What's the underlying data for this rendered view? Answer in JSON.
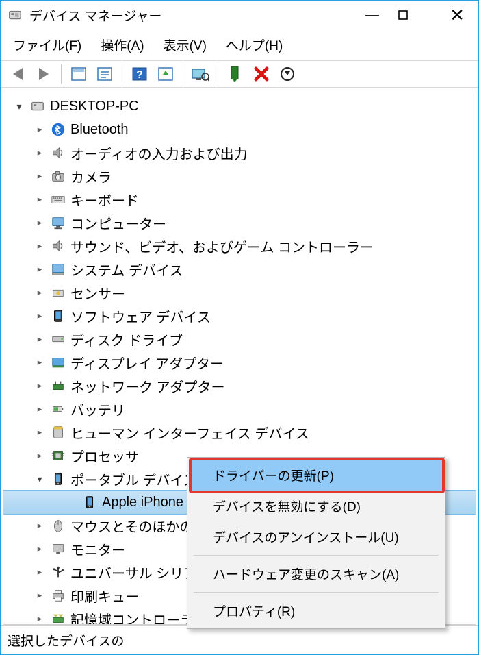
{
  "title": "デバイス マネージャー",
  "menus": {
    "file": "ファイル(F)",
    "action": "操作(A)",
    "view": "表示(V)",
    "help": "ヘルプ(H)"
  },
  "root_node": "DESKTOP-PC",
  "categories": [
    {
      "key": "bluetooth",
      "label": "Bluetooth",
      "icon": "bluetooth"
    },
    {
      "key": "audio_io",
      "label": "オーディオの入力および出力",
      "icon": "speaker"
    },
    {
      "key": "camera",
      "label": "カメラ",
      "icon": "camera"
    },
    {
      "key": "keyboard",
      "label": "キーボード",
      "icon": "keyboard"
    },
    {
      "key": "computer",
      "label": "コンピューター",
      "icon": "monitor"
    },
    {
      "key": "sound",
      "label": "サウンド、ビデオ、およびゲーム コントローラー",
      "icon": "speaker"
    },
    {
      "key": "system",
      "label": "システム デバイス",
      "icon": "system"
    },
    {
      "key": "sensor",
      "label": "センサー",
      "icon": "sensor"
    },
    {
      "key": "software",
      "label": "ソフトウェア デバイス",
      "icon": "software"
    },
    {
      "key": "disk",
      "label": "ディスク ドライブ",
      "icon": "disk"
    },
    {
      "key": "display",
      "label": "ディスプレイ アダプター",
      "icon": "display"
    },
    {
      "key": "network",
      "label": "ネットワーク アダプター",
      "icon": "network"
    },
    {
      "key": "battery",
      "label": "バッテリ",
      "icon": "battery"
    },
    {
      "key": "hid",
      "label": "ヒューマン インターフェイス デバイス",
      "icon": "hid"
    },
    {
      "key": "cpu",
      "label": "プロセッサ",
      "icon": "cpu"
    },
    {
      "key": "portable",
      "label": "ポータブル デバイス",
      "icon": "portable",
      "expanded": true,
      "children": [
        {
          "key": "iphone",
          "label": "Apple iPhone",
          "icon": "portable",
          "selected": true
        }
      ]
    },
    {
      "key": "mouse",
      "label": "マウスとそのほかのポインティング デバイス",
      "icon": "mouse",
      "truncated": true
    },
    {
      "key": "monitor",
      "label": "モニター",
      "icon": "monitor2"
    },
    {
      "key": "usb",
      "label": "ユニバーサル シリアル バス コントローラー",
      "icon": "usb",
      "truncated": true
    },
    {
      "key": "print",
      "label": "印刷キュー",
      "icon": "printer"
    },
    {
      "key": "storage",
      "label": "記憶域コントローラー",
      "icon": "storage",
      "truncated": true
    }
  ],
  "context_menu": {
    "update": "ドライバーの更新(P)",
    "disable": "デバイスを無効にする(D)",
    "uninstall": "デバイスのアンインストール(U)",
    "scan": "ハードウェア変更のスキャン(A)",
    "props": "プロパティ(R)"
  },
  "status": "選択したデバイスの"
}
